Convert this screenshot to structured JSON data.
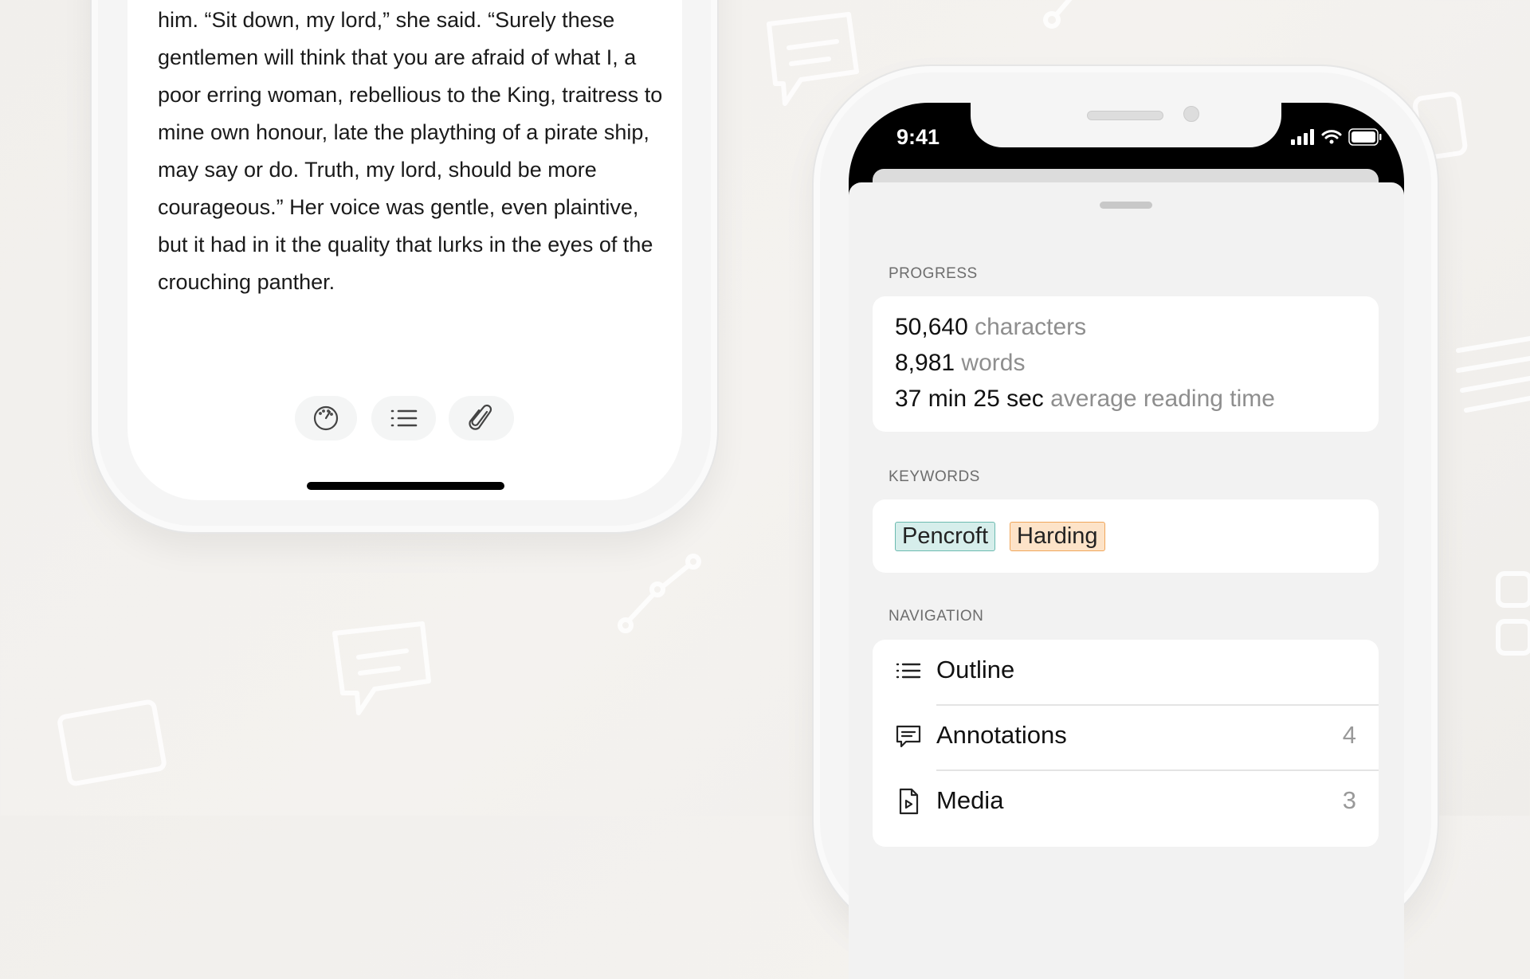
{
  "reader": {
    "text": "him. “Sit down, my lord,” she said. “Surely these gentlemen will think that you are afraid of what I, a poor erring woman, rebellious to the King, traitress to mine own honour, late the plaything of a pirate ship, may say or do. Truth, my lord, should be more courageous.” Her voice was gentle, even plaintive, but it had in it the quality that lurks in the eyes of the crouching panther.",
    "toolbar": [
      {
        "icon": "gauge-icon"
      },
      {
        "icon": "list-icon"
      },
      {
        "icon": "paperclip-icon"
      }
    ]
  },
  "status_bar": {
    "time": "9:41"
  },
  "progress": {
    "label": "PROGRESS",
    "characters": {
      "value": "50,640",
      "unit": "characters"
    },
    "words": {
      "value": "8,981",
      "unit": "words"
    },
    "reading_time": {
      "value": "37 min 25 sec",
      "unit": "average reading time"
    }
  },
  "keywords": {
    "label": "KEYWORDS",
    "items": [
      {
        "text": "Pencroft",
        "bg": "#d6eeeb",
        "border": "#6cbab0"
      },
      {
        "text": "Harding",
        "bg": "#fde3c8",
        "border": "#f0a65a"
      }
    ]
  },
  "navigation": {
    "label": "NAVIGATION",
    "items": [
      {
        "label": "Outline",
        "icon": "list-icon",
        "count": ""
      },
      {
        "label": "Annotations",
        "icon": "speech-bubble-icon",
        "count": "4"
      },
      {
        "label": "Media",
        "icon": "media-file-icon",
        "count": "3"
      }
    ]
  }
}
